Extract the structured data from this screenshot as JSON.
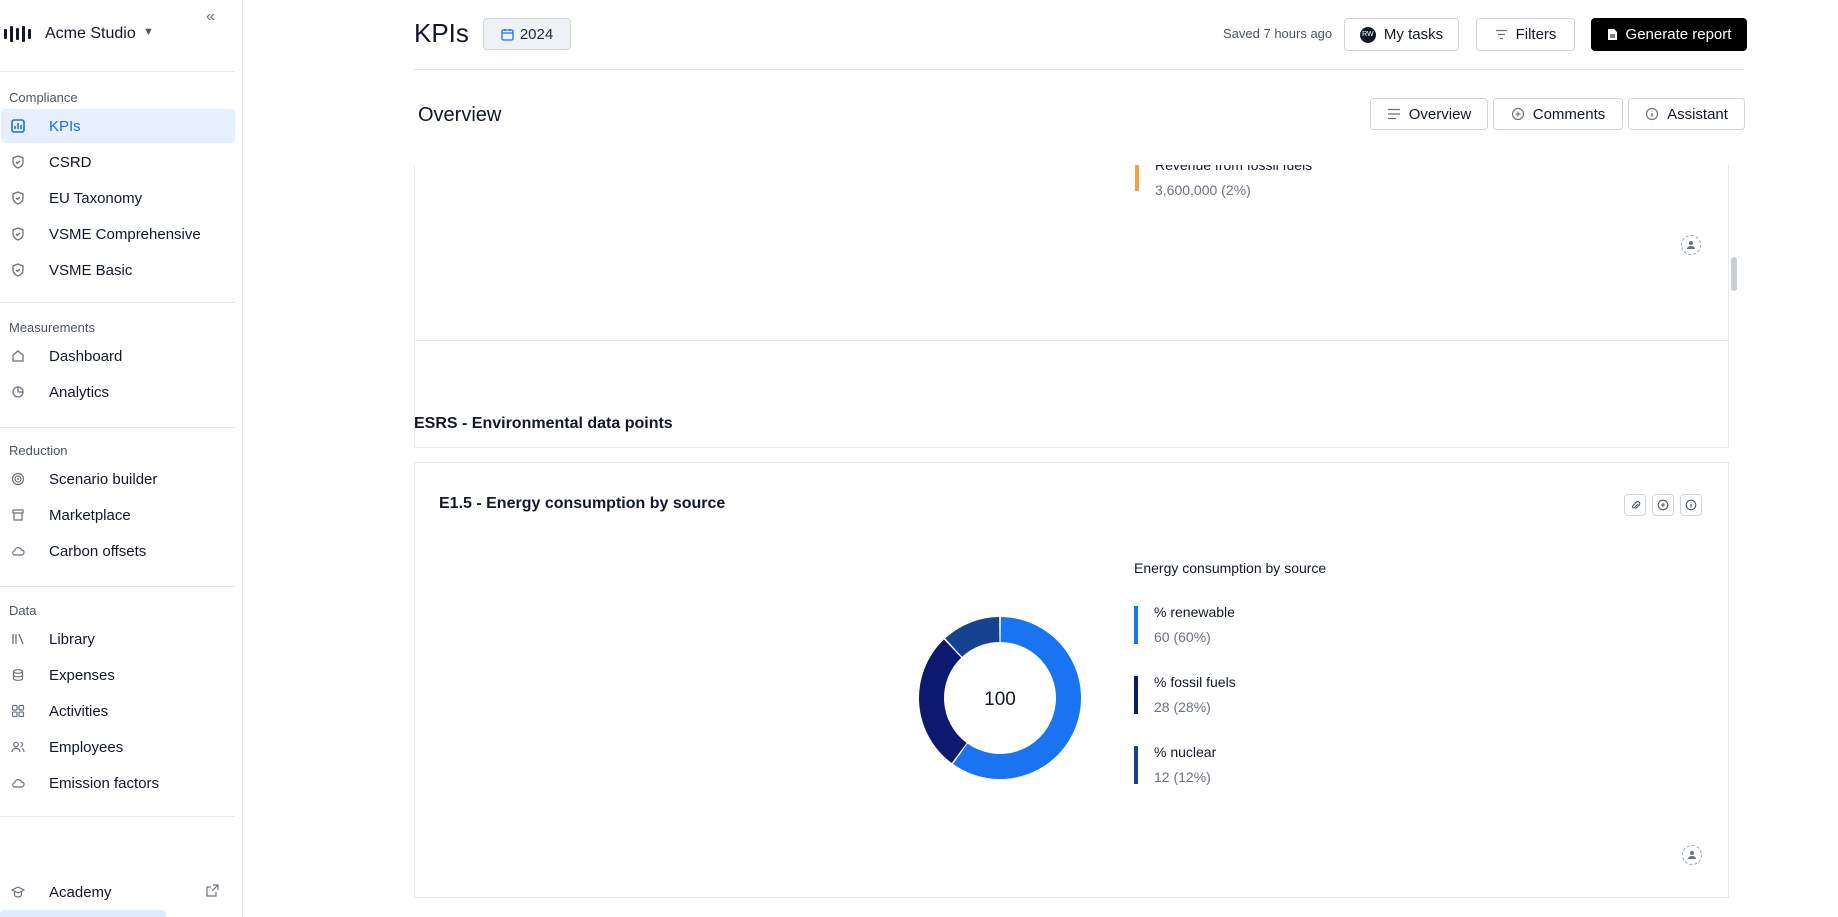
{
  "app": {
    "workspace_name": "Acme Studio"
  },
  "sidebar": {
    "sections": [
      {
        "title": "Compliance",
        "items": [
          {
            "label": "KPIs",
            "icon": "chart-icon",
            "active": true
          },
          {
            "label": "CSRD",
            "icon": "shield-icon"
          },
          {
            "label": "EU Taxonomy",
            "icon": "shield-icon"
          },
          {
            "label": "VSME Comprehensive",
            "icon": "shield-icon"
          },
          {
            "label": "VSME Basic",
            "icon": "shield-icon"
          }
        ]
      },
      {
        "title": "Measurements",
        "items": [
          {
            "label": "Dashboard",
            "icon": "home-icon"
          },
          {
            "label": "Analytics",
            "icon": "pie-icon"
          }
        ]
      },
      {
        "title": "Reduction",
        "items": [
          {
            "label": "Scenario builder",
            "icon": "target-icon"
          },
          {
            "label": "Marketplace",
            "icon": "store-icon"
          },
          {
            "label": "Carbon offsets",
            "icon": "cloud-icon"
          }
        ]
      },
      {
        "title": "Data",
        "items": [
          {
            "label": "Library",
            "icon": "library-icon"
          },
          {
            "label": "Expenses",
            "icon": "coins-icon"
          },
          {
            "label": "Activities",
            "icon": "grid-icon"
          },
          {
            "label": "Employees",
            "icon": "users-icon"
          },
          {
            "label": "Emission factors",
            "icon": "cloud-icon"
          }
        ]
      }
    ],
    "footer_item": {
      "label": "Academy",
      "icon": "graduation-cap-icon"
    }
  },
  "header": {
    "title": "KPIs",
    "year": "2024",
    "saved_status": "Saved 7 hours ago",
    "my_tasks_label": "My tasks",
    "avatar_initials": "RW",
    "filters_label": "Filters",
    "generate_report_label": "Generate report"
  },
  "overview": {
    "title": "Overview",
    "tabs": {
      "overview": "Overview",
      "comments": "Comments",
      "assistant": "Assistant"
    }
  },
  "previous_card": {
    "legend": [
      {
        "name": "Revenue from fossil fuels",
        "value": "3,600,000 (2%)",
        "color": "#f59e42"
      }
    ]
  },
  "esrs_section": {
    "heading": "ESRS - Environmental data points",
    "card": {
      "title": "E1.5 - Energy consumption by source"
    }
  },
  "chart_data": {
    "type": "pie",
    "title": "Energy consumption by source",
    "center_label": "100",
    "categories": [
      "% renewable",
      "% fossil fuels",
      "% nuclear"
    ],
    "values": [
      60,
      28,
      12
    ],
    "value_labels": [
      "60 (60%)",
      "28 (28%)",
      "12 (12%)"
    ],
    "colors": [
      "#1a73f0",
      "#0b1a6e",
      "#16438f"
    ],
    "legend_placement": "right"
  }
}
